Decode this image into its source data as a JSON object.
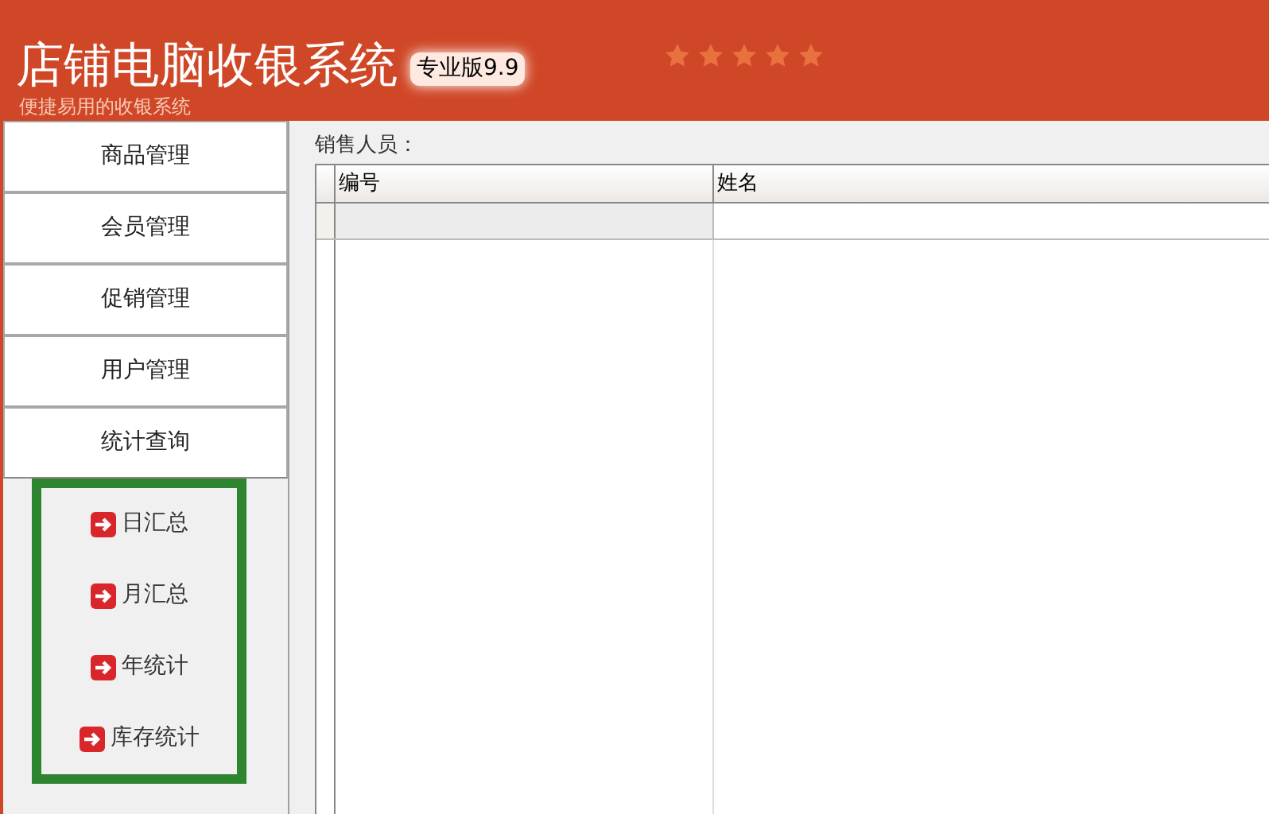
{
  "header": {
    "title": "店铺电脑收银系统",
    "edition": "专业版9.9",
    "subtitle": "便捷易用的收银系统",
    "stars": 5
  },
  "sidebar": {
    "items": [
      {
        "label": "商品管理",
        "expanded": false
      },
      {
        "label": "会员管理",
        "expanded": false
      },
      {
        "label": "促销管理",
        "expanded": false
      },
      {
        "label": "用户管理",
        "expanded": false
      },
      {
        "label": "统计查询",
        "expanded": true,
        "children": [
          {
            "label": "日汇总"
          },
          {
            "label": "月汇总"
          },
          {
            "label": "年统计"
          },
          {
            "label": "库存统计"
          }
        ]
      }
    ]
  },
  "main": {
    "label": "销售人员：",
    "table": {
      "columns": [
        "编号",
        "姓名"
      ],
      "rows": [
        {
          "selected": true
        }
      ]
    }
  }
}
